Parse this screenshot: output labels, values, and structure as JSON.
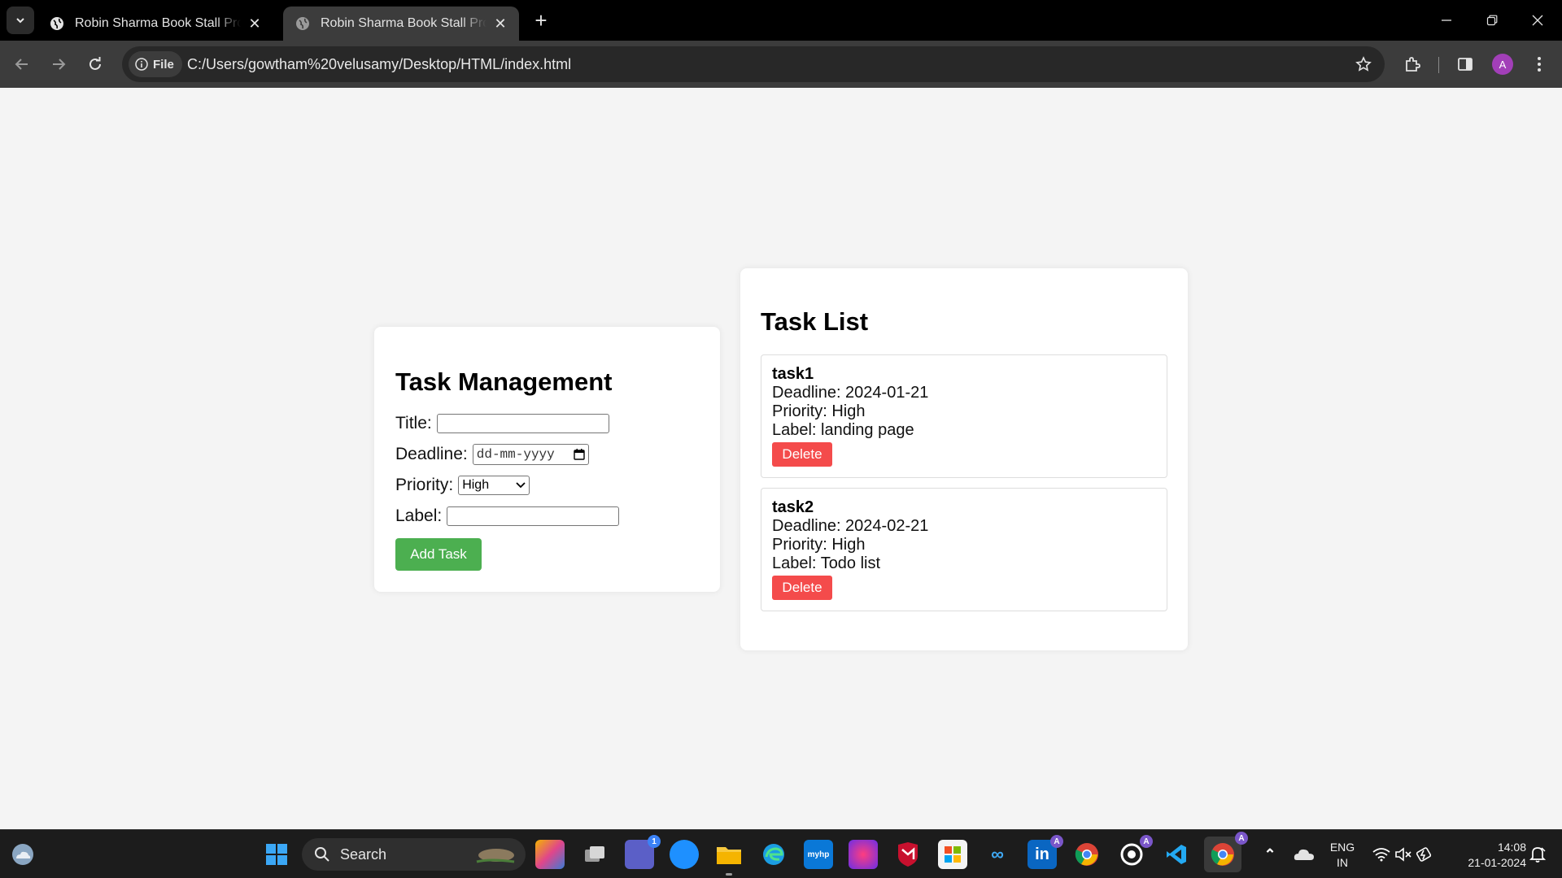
{
  "browser": {
    "tabs": [
      {
        "title": "Robin Sharma Book Stall Project",
        "active": false
      },
      {
        "title": "Robin Sharma Book Stall Project",
        "active": true
      }
    ],
    "new_tab_icon": "plus-icon",
    "chip_label": "File",
    "url": "C:/Users/gowtham%20velusamy/Desktop/HTML/index.html",
    "profile_initial": "A"
  },
  "form": {
    "heading": "Task Management",
    "title_label": "Title:",
    "title_value": "",
    "deadline_label": "Deadline:",
    "deadline_placeholder": "dd-mm-yyyy",
    "priority_label": "Priority:",
    "priority_value": "High",
    "label_label": "Label:",
    "label_value": "",
    "add_button": "Add Task"
  },
  "task_list": {
    "heading": "Task List",
    "tasks": [
      {
        "name": "task1",
        "deadline": "Deadline: 2024-01-21",
        "priority": "Priority: High",
        "label": "Label: landing page",
        "delete": "Delete"
      },
      {
        "name": "task2",
        "deadline": "Deadline: 2024-02-21",
        "priority": "Priority: High",
        "label": "Label: Todo list",
        "delete": "Delete"
      }
    ]
  },
  "colors": {
    "add_button": "#4caf50",
    "delete_button": "#f44b4b",
    "page_bg": "#f4f4f4"
  },
  "taskbar": {
    "search_label": "Search",
    "chat_badge": "1",
    "lang_line1": "ENG",
    "lang_line2": "IN",
    "time": "14:08",
    "date": "21-01-2024"
  }
}
